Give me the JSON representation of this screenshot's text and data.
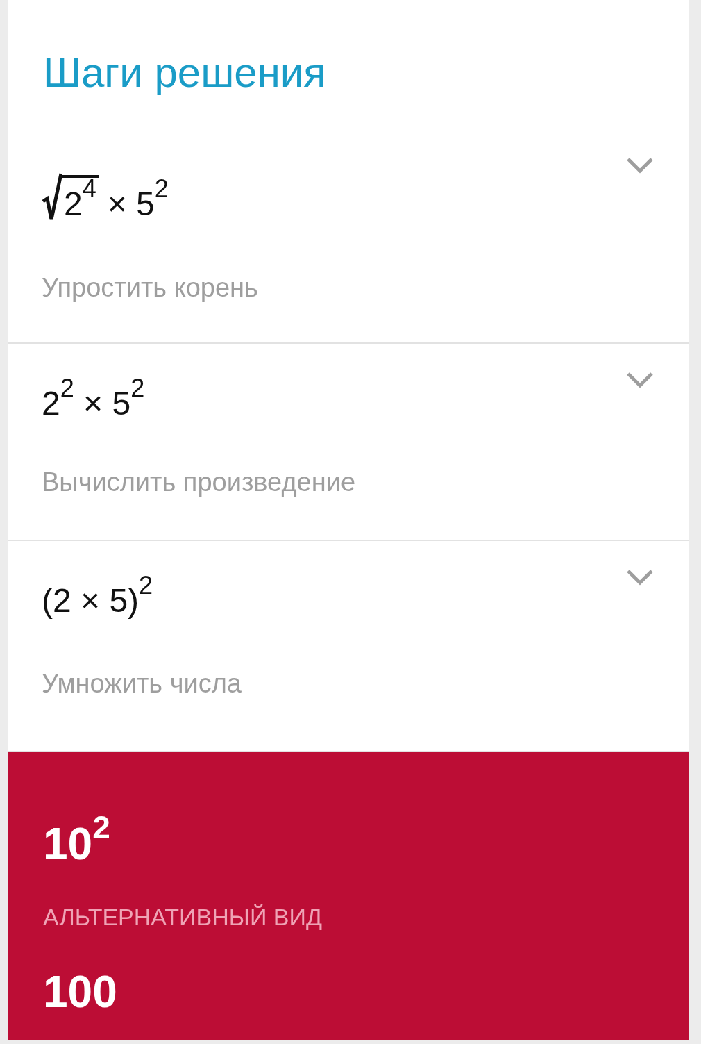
{
  "title": "Шаги решения",
  "steps": [
    {
      "kind": "root",
      "radicand": "2$^{4}$",
      "expression": "× 5$^{2}$",
      "description": "Упростить корень",
      "expanded": false
    },
    {
      "kind": "plain",
      "expression": "2$^{2}$ × 5$^{2}$",
      "description": "Вычислить произведение",
      "expanded": false
    },
    {
      "kind": "plain",
      "expression": "(2 × 5)$^{2}$",
      "description": "Умножить числа",
      "expanded": false
    }
  ],
  "result": {
    "expression": "10$^{2}$",
    "alt_label": "АЛЬТЕРНАТИВНЫЙ ВИД",
    "alt_value": "100"
  }
}
